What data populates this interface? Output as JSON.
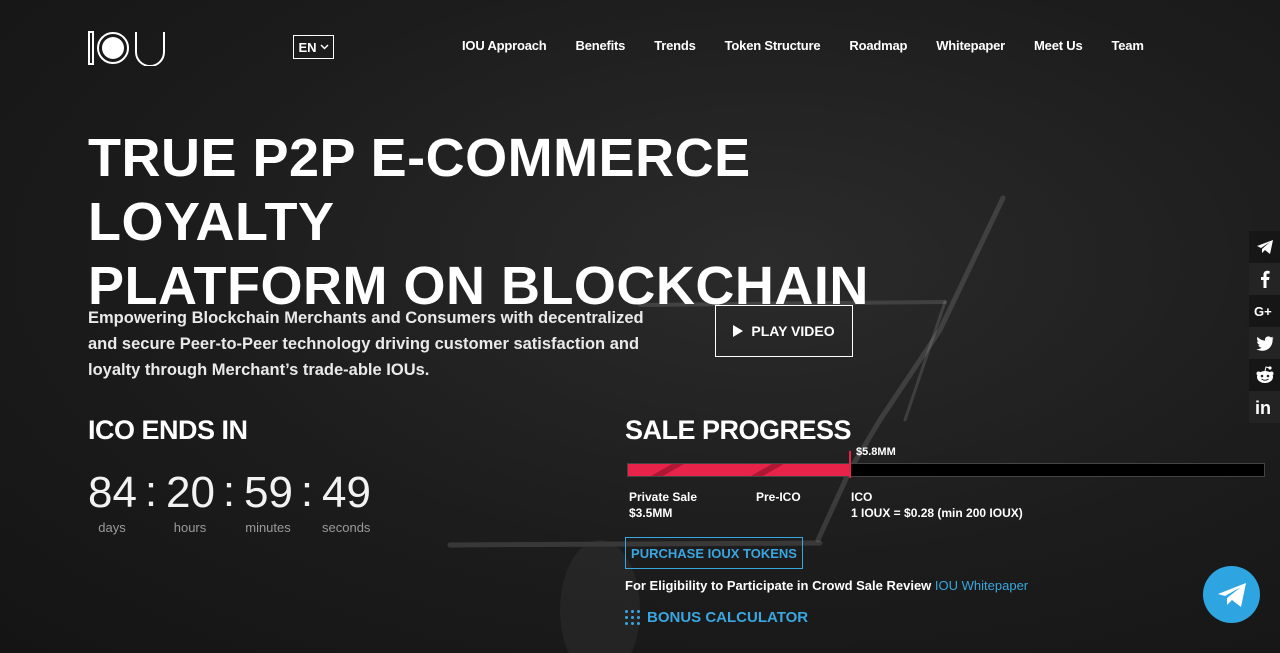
{
  "header": {
    "logo_alt": "IOU",
    "language": "EN",
    "nav": [
      "IOU Approach",
      "Benefits",
      "Trends",
      "Token Structure",
      "Roadmap",
      "Whitepaper",
      "Meet Us",
      "Team"
    ]
  },
  "hero": {
    "title_line1": "TRUE P2P E-COMMERCE LOYALTY",
    "title_line2": "PLATFORM ON BLOCKCHAIN",
    "description": "Empowering Blockchain Merchants and Consumers with decentralized and secure Peer-to-Peer technology driving customer satisfaction and loyalty through Merchant’s trade-able IOUs.",
    "play_label": "PLAY VIDEO"
  },
  "ico": {
    "title": "ICO ENDS IN",
    "countdown": [
      {
        "value": "84",
        "label": "days"
      },
      {
        "value": "20",
        "label": "hours"
      },
      {
        "value": "59",
        "label": "minutes"
      },
      {
        "value": "49",
        "label": "seconds"
      }
    ],
    "separator": ":"
  },
  "sale": {
    "title": "SALE PROGRESS",
    "raised_label": "$5.8MM",
    "progress_fraction": 0.35,
    "stages": [
      {
        "name": "Private Sale",
        "detail": "$3.5MM"
      },
      {
        "name": "Pre-ICO",
        "detail": ""
      },
      {
        "name": "ICO",
        "detail": "1 IOUX = $0.28 (min 200 IOUX)"
      }
    ],
    "purchase_label": "PURCHASE IOUX TOKENS",
    "eligibility_text": "For Eligibility to Participate in Crowd Sale Review",
    "eligibility_link": "IOU Whitepaper",
    "bonus_label": "BONUS CALCULATOR"
  },
  "social": [
    "telegram-icon",
    "facebook-icon",
    "google-plus-icon",
    "twitter-icon",
    "reddit-icon",
    "linkedin-icon"
  ],
  "colors": {
    "accent_red": "#e8234a",
    "accent_blue": "#3aa6e0",
    "background": "#1c1c1c"
  }
}
